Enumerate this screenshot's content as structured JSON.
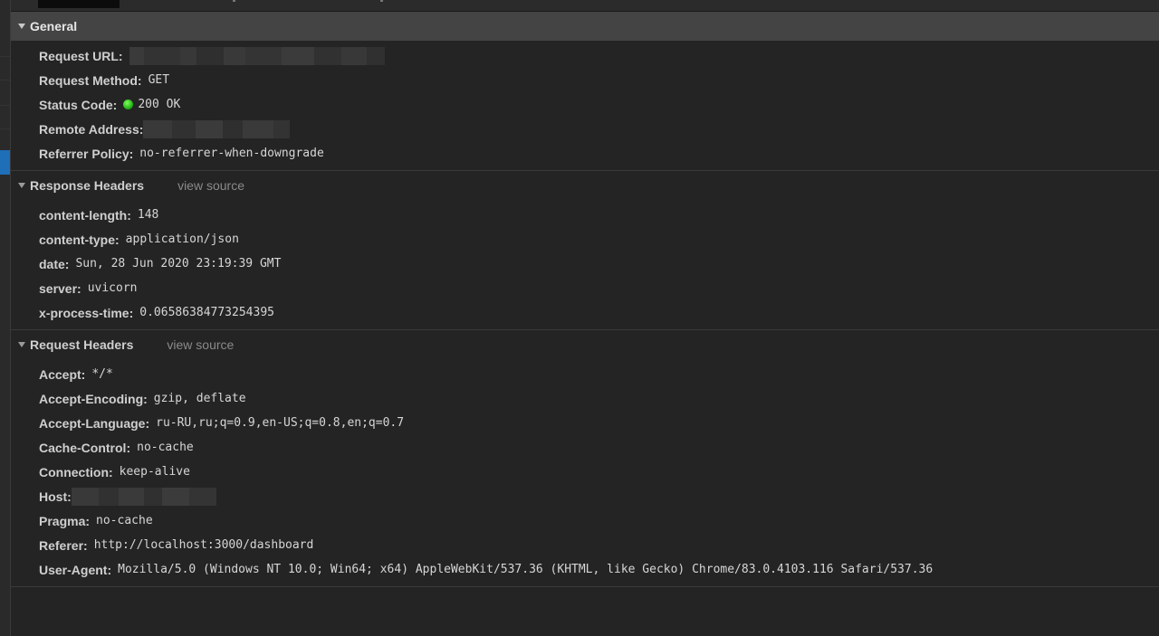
{
  "general": {
    "title": "General",
    "rows": [
      {
        "key": "Request URL:",
        "value": ""
      },
      {
        "key": "Request Method:",
        "value": "GET"
      },
      {
        "key": "Status Code:",
        "value": "200 OK",
        "status_color": "#2ecc1a"
      },
      {
        "key": "Remote Address:",
        "value": ""
      },
      {
        "key": "Referrer Policy:",
        "value": "no-referrer-when-downgrade"
      }
    ]
  },
  "response_headers": {
    "title": "Response Headers",
    "view_source": "view source",
    "rows": [
      {
        "key": "content-length:",
        "value": "148"
      },
      {
        "key": "content-type:",
        "value": "application/json"
      },
      {
        "key": "date:",
        "value": "Sun, 28 Jun 2020 23:19:39 GMT"
      },
      {
        "key": "server:",
        "value": "uvicorn"
      },
      {
        "key": "x-process-time:",
        "value": "0.06586384773254395"
      }
    ]
  },
  "request_headers": {
    "title": "Request Headers",
    "view_source": "view source",
    "rows": [
      {
        "key": "Accept:",
        "value": "*/*"
      },
      {
        "key": "Accept-Encoding:",
        "value": "gzip, deflate"
      },
      {
        "key": "Accept-Language:",
        "value": "ru-RU,ru;q=0.9,en-US;q=0.8,en;q=0.7"
      },
      {
        "key": "Cache-Control:",
        "value": "no-cache"
      },
      {
        "key": "Connection:",
        "value": "keep-alive"
      },
      {
        "key": "Host:",
        "value": ""
      },
      {
        "key": "Pragma:",
        "value": "no-cache"
      },
      {
        "key": "Referer:",
        "value": "http://localhost:3000/dashboard"
      },
      {
        "key": "User-Agent:",
        "value": "Mozilla/5.0 (Windows NT 10.0; Win64; x64) AppleWebKit/537.36 (KHTML, like Gecko) Chrome/83.0.4103.116 Safari/537.36"
      }
    ]
  },
  "colors": {
    "background": "#242424",
    "section_header_bg": "#444444",
    "selected_row_accent": "#1e6fb8",
    "status_ok": "#2ecc1a"
  }
}
